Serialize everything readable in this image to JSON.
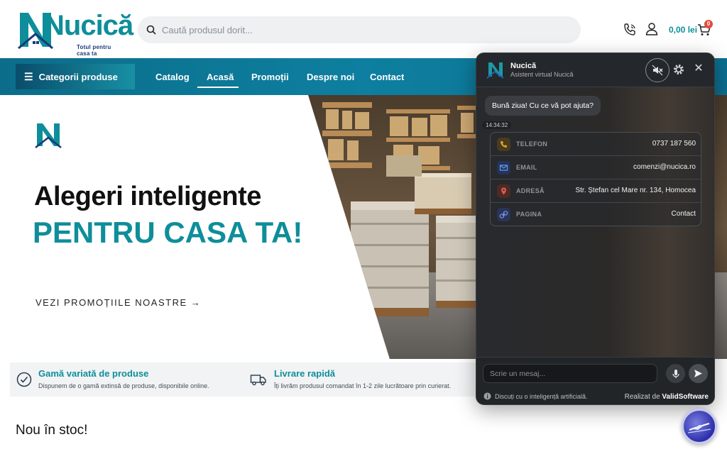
{
  "header": {
    "logo_text": "Nucică",
    "logo_tagline": "Totul pentru casa ta",
    "search_placeholder": "Caută produsul dorit...",
    "cart_total": "0,00 lei",
    "cart_count": "0",
    "icons": [
      "phone-icon",
      "user-icon",
      "cart-icon",
      "search-icon"
    ]
  },
  "nav": {
    "categories_label": "Categorii produse",
    "items": [
      {
        "label": "Catalog"
      },
      {
        "label": "Acasă",
        "active": true
      },
      {
        "label": "Promoții"
      },
      {
        "label": "Despre noi"
      },
      {
        "label": "Contact"
      }
    ]
  },
  "hero": {
    "line1": "Alegeri inteligente",
    "line2": "PENTRU CASA TA!",
    "cta": "VEZI PROMOȚIILE NOASTRE →"
  },
  "features": [
    {
      "title": "Gamă variată de produse",
      "desc": "Dispunem de o gamă extinsă de produse, disponibile online.",
      "icon": "check-circle-icon"
    },
    {
      "title": "Livrare rapidă",
      "desc": "Îți livrăm produsul comandat în 1-2 zile lucrătoare prin curierat.",
      "icon": "truck-icon"
    }
  ],
  "section_title": "Nou în stoc!",
  "chat": {
    "name": "Nucică",
    "subtitle": "Asistent virtual Nucică",
    "greeting": "Bună ziua! Cu ce vă pot ajuta?",
    "time": "14:34:32",
    "contacts": [
      {
        "label": "TELEFON",
        "value": "0737 187 560",
        "icon": "phone-icon",
        "color": "#c9962e"
      },
      {
        "label": "EMAIL",
        "value": "comenzi@nucica.ro",
        "icon": "mail-icon",
        "color": "#4f7fd6"
      },
      {
        "label": "ADRESĂ",
        "value": "Str. Ștefan cel Mare nr. 134, Homocea",
        "icon": "location-pin-icon",
        "color": "#d65a4a"
      },
      {
        "label": "PAGINA",
        "value": "Contact",
        "icon": "link-icon",
        "color": "#6a86d8"
      }
    ],
    "input_placeholder": "Scrie un mesaj...",
    "ai_note": "Discuți cu o inteligență artificială.",
    "made_by_prefix": "Realizat de",
    "made_by_brand": "ValidSoftware"
  },
  "colors": {
    "brand_teal": "#0e8e9a",
    "nav_blue": "#0c6e8e",
    "chat_bg": "#2a2d31"
  }
}
